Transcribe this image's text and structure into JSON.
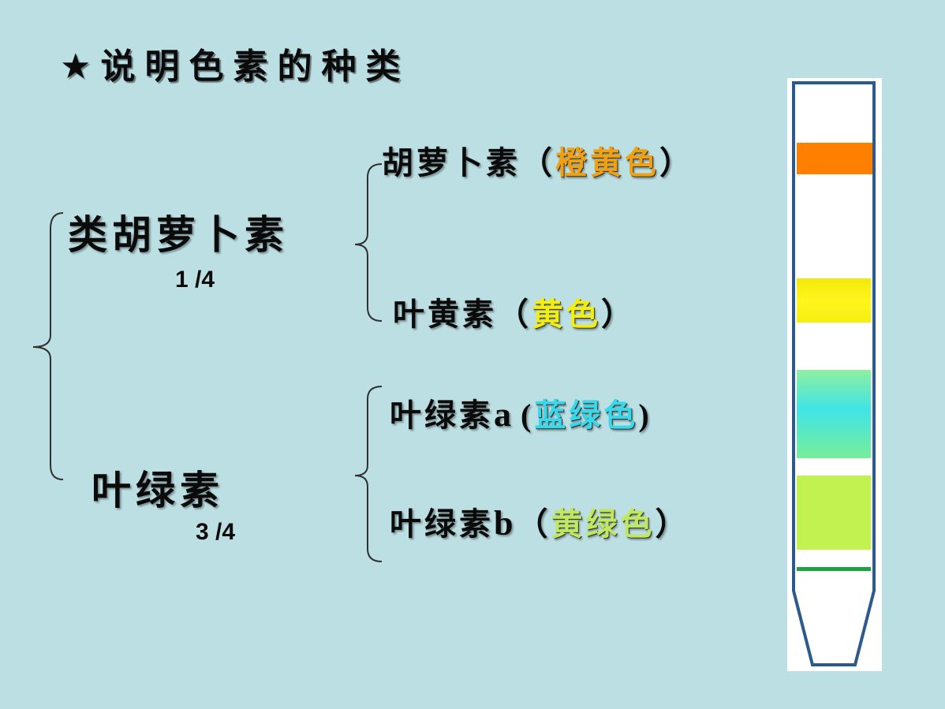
{
  "title": "★说明色素的种类",
  "groups": [
    {
      "name": "类胡萝卜素",
      "fraction": "1 /4",
      "items": [
        {
          "name": "胡萝卜素",
          "open": "（",
          "color_name": "橙黄色",
          "close": "）",
          "color": "#f0a010"
        },
        {
          "name": "叶黄素",
          "open": "（",
          "color_name": "黄色",
          "close": "）",
          "color": "#f2ee10"
        }
      ]
    },
    {
      "name": "叶绿素",
      "fraction": "3 /4",
      "items": [
        {
          "name": "叶绿素",
          "suffix": "a",
          "open": "(",
          "color_name": "蓝绿色",
          "close": ")",
          "color": "#38d8ea"
        },
        {
          "name": "叶绿素",
          "suffix": "b",
          "open": "（",
          "color_name": "黄绿色",
          "close": "）",
          "color": "#bfe860"
        }
      ]
    }
  ],
  "tube": {
    "band_colors": [
      "#ff7f00",
      "#f5f010",
      "#40e0e0",
      "#c2f250",
      "#20a040"
    ],
    "outline_color": "#2c5a8c"
  }
}
